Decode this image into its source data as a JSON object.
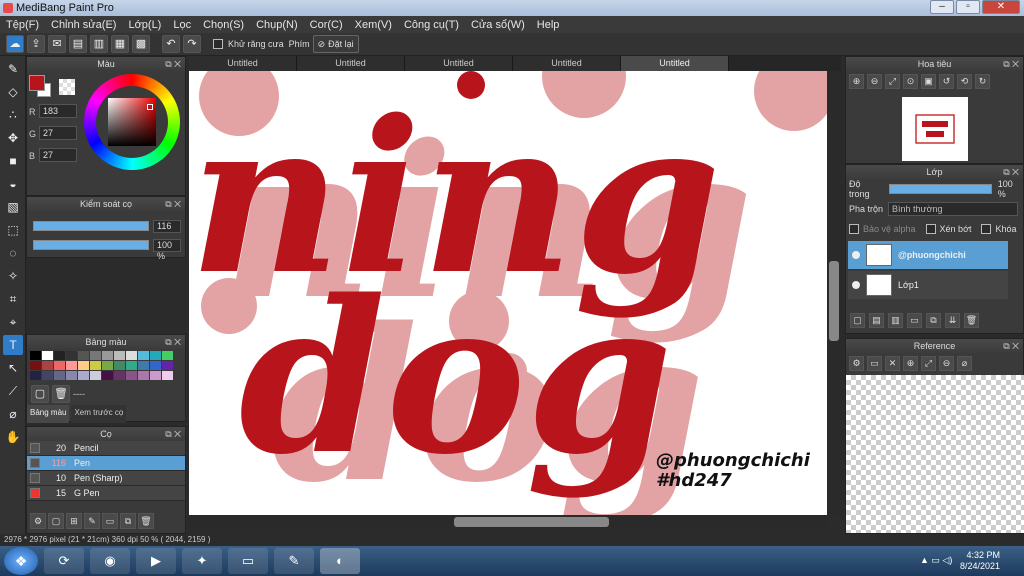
{
  "window": {
    "title": "MediBang Paint Pro",
    "controls": [
      "–",
      "▫",
      "✕"
    ]
  },
  "menu": [
    "Tệp(F)",
    "Chỉnh sửa(E)",
    "Lớp(L)",
    "Lọc",
    "Chọn(S)",
    "Chụp(N)",
    "Cor(C)",
    "Xem(V)",
    "Công cụ(T)",
    "Cửa sổ(W)",
    "Help"
  ],
  "toolbar": {
    "antialias_label": "Khử răng cưa",
    "keys_label": "Phím",
    "reset_label": "Đặt lại"
  },
  "tabs": [
    "Untitled",
    "Untitled",
    "Untitled",
    "Untitled",
    "Untitled"
  ],
  "color_panel": {
    "title": "Màu",
    "r_label": "R",
    "g_label": "G",
    "b_label": "B",
    "r": "183",
    "g": "27",
    "b": "27",
    "fg": "#b7151b"
  },
  "brush_control": {
    "title": "Kiểm soát cọ",
    "size": "116",
    "opacity": "100 %"
  },
  "palette": {
    "title": "Bảng màu",
    "tab_palette": "Bảng màu",
    "tab_preview": "Xem trước cọ",
    "dots": "----"
  },
  "brush_panel": {
    "title": "Cọ",
    "items": [
      {
        "size": "20",
        "name": "Pencil"
      },
      {
        "size": "116",
        "name": "Pen"
      },
      {
        "size": "10",
        "name": "Pen (Sharp)"
      },
      {
        "size": "15",
        "name": "G Pen"
      }
    ]
  },
  "navigator": {
    "title": "Hoa tiêu"
  },
  "layers": {
    "title": "Lớp",
    "opacity_label": "Độ trong",
    "opacity": "100 %",
    "blend_label": "Pha trộn",
    "blend": "Bình thường",
    "protect_alpha": "Bảo vệ alpha",
    "clipping": "Xén bớt",
    "lock": "Khóa",
    "items": [
      {
        "name": "@phuongchichi"
      },
      {
        "name": "Lớp1"
      }
    ]
  },
  "reference": {
    "title": "Reference"
  },
  "artwork": {
    "line1": "ning",
    "line2": "dog",
    "watermark1": "@phuongchichi",
    "watermark2": "#hd247"
  },
  "status": {
    "text": "2976 * 2976 pixel   (21 * 21cm)   360 dpi   50 %   ( 2044, 2159 )"
  },
  "taskbar": {
    "time": "4:32 PM",
    "date": "8/24/2021"
  },
  "colors": {
    "accent": "#2f7dc8",
    "ink": "#b7151b",
    "shadow": "#e3a3a5"
  }
}
